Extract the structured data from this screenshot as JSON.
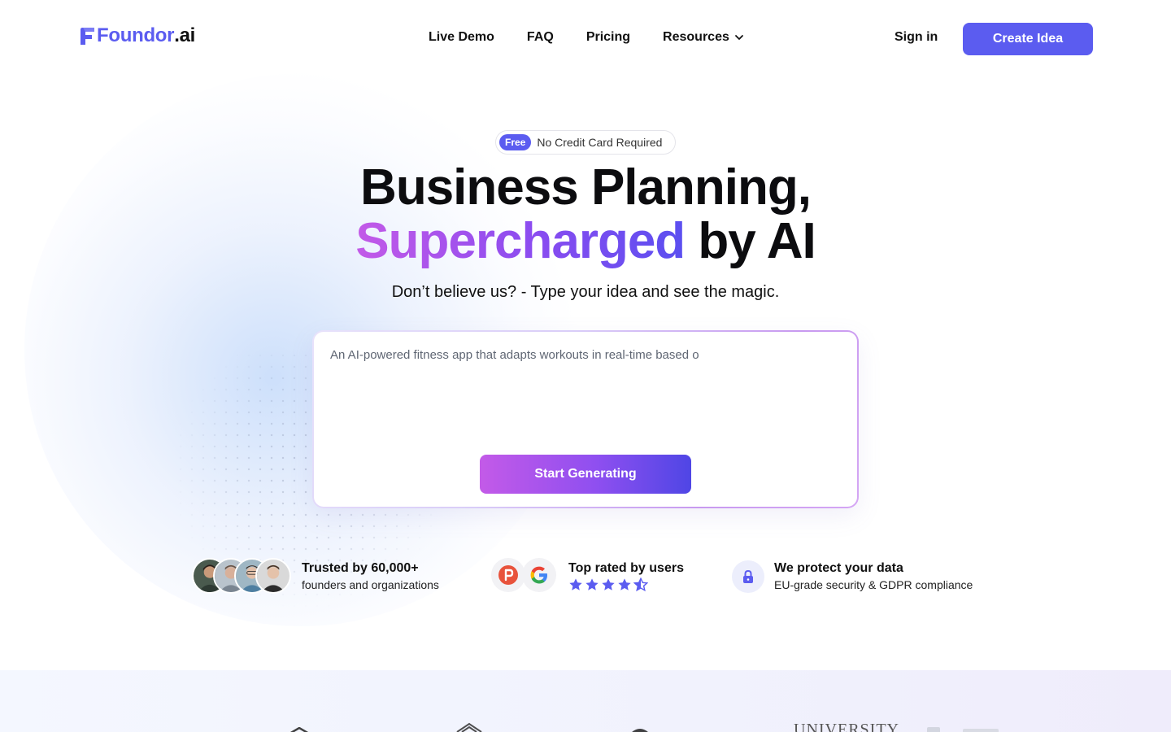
{
  "brand": {
    "name": "Foundor",
    "suffix": ".ai",
    "color": "#5b5cf0"
  },
  "nav": {
    "links": [
      {
        "label": "Live Demo"
      },
      {
        "label": "FAQ"
      },
      {
        "label": "Pricing"
      },
      {
        "label": "Resources",
        "has_dropdown": true
      }
    ],
    "sign_in": "Sign in",
    "cta": "Create Idea"
  },
  "badge": {
    "pill": "Free",
    "text": "No Credit Card Required"
  },
  "hero": {
    "title_line1": "Business Planning,",
    "title_highlight": "Supercharged",
    "title_rest": "by AI",
    "subtitle": "Don’t believe us? - Type your idea and see the magic."
  },
  "idea_box": {
    "value": "An AI-powered fitness app that adapts workouts in real-time based o",
    "button": "Start Generating"
  },
  "trust": [
    {
      "title": "Trusted by 60,000+",
      "subtitle": "founders and organizations"
    },
    {
      "title": "Top rated by users",
      "rating": 4.5,
      "rating_max": 5,
      "icons": [
        "product-hunt-icon",
        "google-icon"
      ]
    },
    {
      "title": "We protect your data",
      "subtitle": "EU-grade security & GDPR compliance",
      "icon": "lock-icon"
    }
  ],
  "logos_band": {
    "partial_text": "UNIVERSITY"
  },
  "colors": {
    "accent": "#5b5cf0",
    "gradient_start": "#c35ae8",
    "gradient_end": "#4f46e5",
    "star": "#5b5cf0"
  }
}
